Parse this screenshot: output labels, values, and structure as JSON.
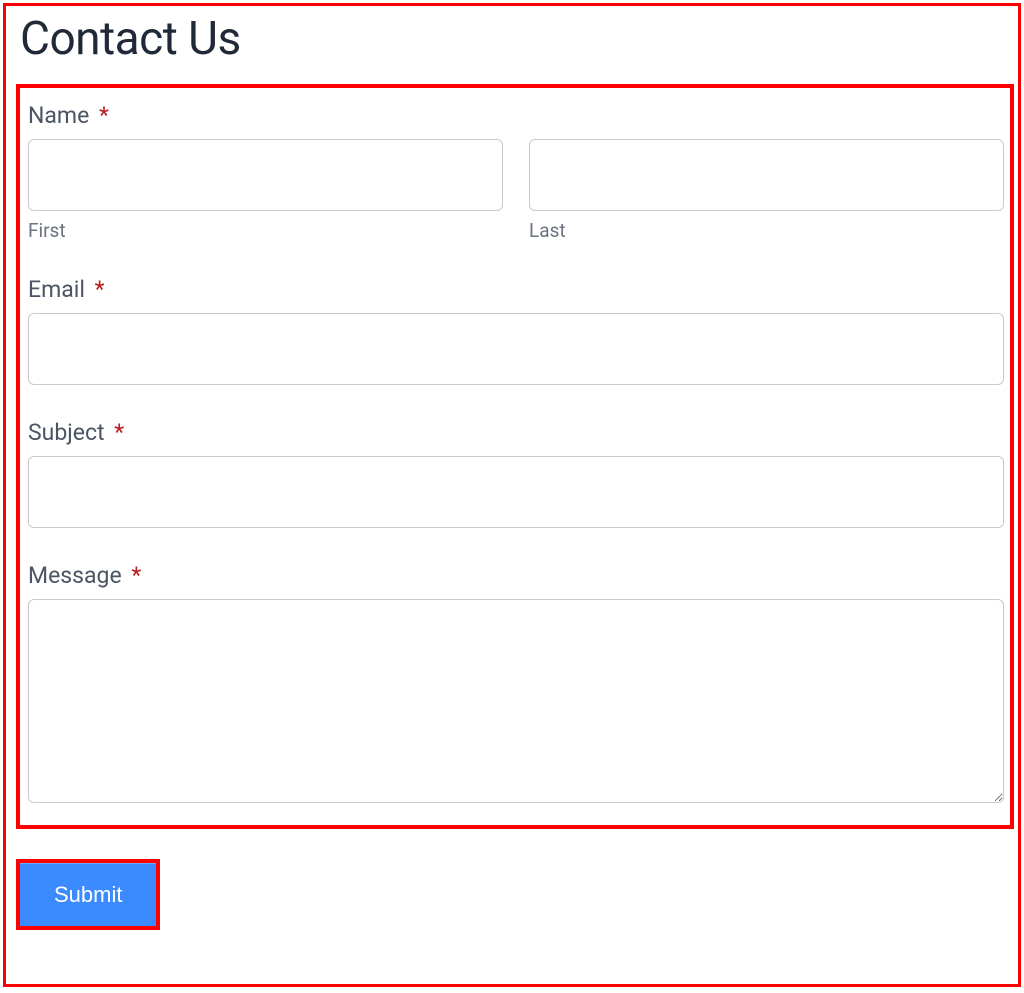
{
  "title": "Contact Us",
  "required_mark": "*",
  "fields": {
    "name": {
      "label": "Name",
      "first_sublabel": "First",
      "last_sublabel": "Last",
      "first_value": "",
      "last_value": ""
    },
    "email": {
      "label": "Email",
      "value": ""
    },
    "subject": {
      "label": "Subject",
      "value": ""
    },
    "message": {
      "label": "Message",
      "value": ""
    }
  },
  "submit_label": "Submit"
}
